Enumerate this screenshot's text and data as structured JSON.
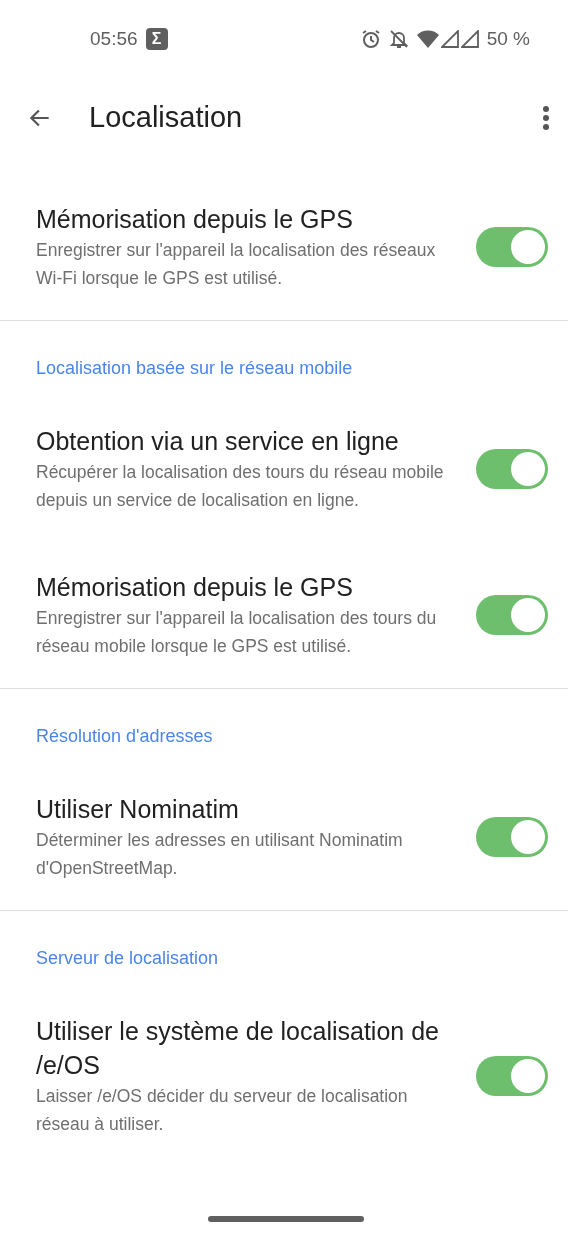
{
  "status_bar": {
    "time": "05:56",
    "notification_glyph": "Σ",
    "battery": "50 %"
  },
  "app_bar": {
    "title": "Localisation"
  },
  "sections": [
    {
      "items": [
        {
          "title": "Mémorisation depuis le GPS",
          "summary": "Enregistrer sur l'appareil la localisation des réseaux Wi-Fi lorsque le GPS est utilisé.",
          "on": true
        }
      ]
    },
    {
      "header": "Localisation basée sur le réseau mobile",
      "items": [
        {
          "title": "Obtention via un service en ligne",
          "summary": "Récupérer la localisation des tours du réseau mobile depuis un service de localisation en ligne.",
          "on": true
        },
        {
          "title": "Mémorisation depuis le GPS",
          "summary": "Enregistrer sur l'appareil la localisation des tours du réseau mobile lorsque le GPS est utilisé.",
          "on": true
        }
      ]
    },
    {
      "header": "Résolution d'adresses",
      "items": [
        {
          "title": "Utiliser Nominatim",
          "summary": "Déterminer les adresses en utilisant Nominatim d'OpenStreetMap.",
          "on": true
        }
      ]
    },
    {
      "header": "Serveur de localisation",
      "items": [
        {
          "title": "Utiliser le système de localisation de /e/OS",
          "summary": "Laisser /e/OS décider du serveur de localisation réseau à utiliser.",
          "on": true
        }
      ]
    }
  ]
}
